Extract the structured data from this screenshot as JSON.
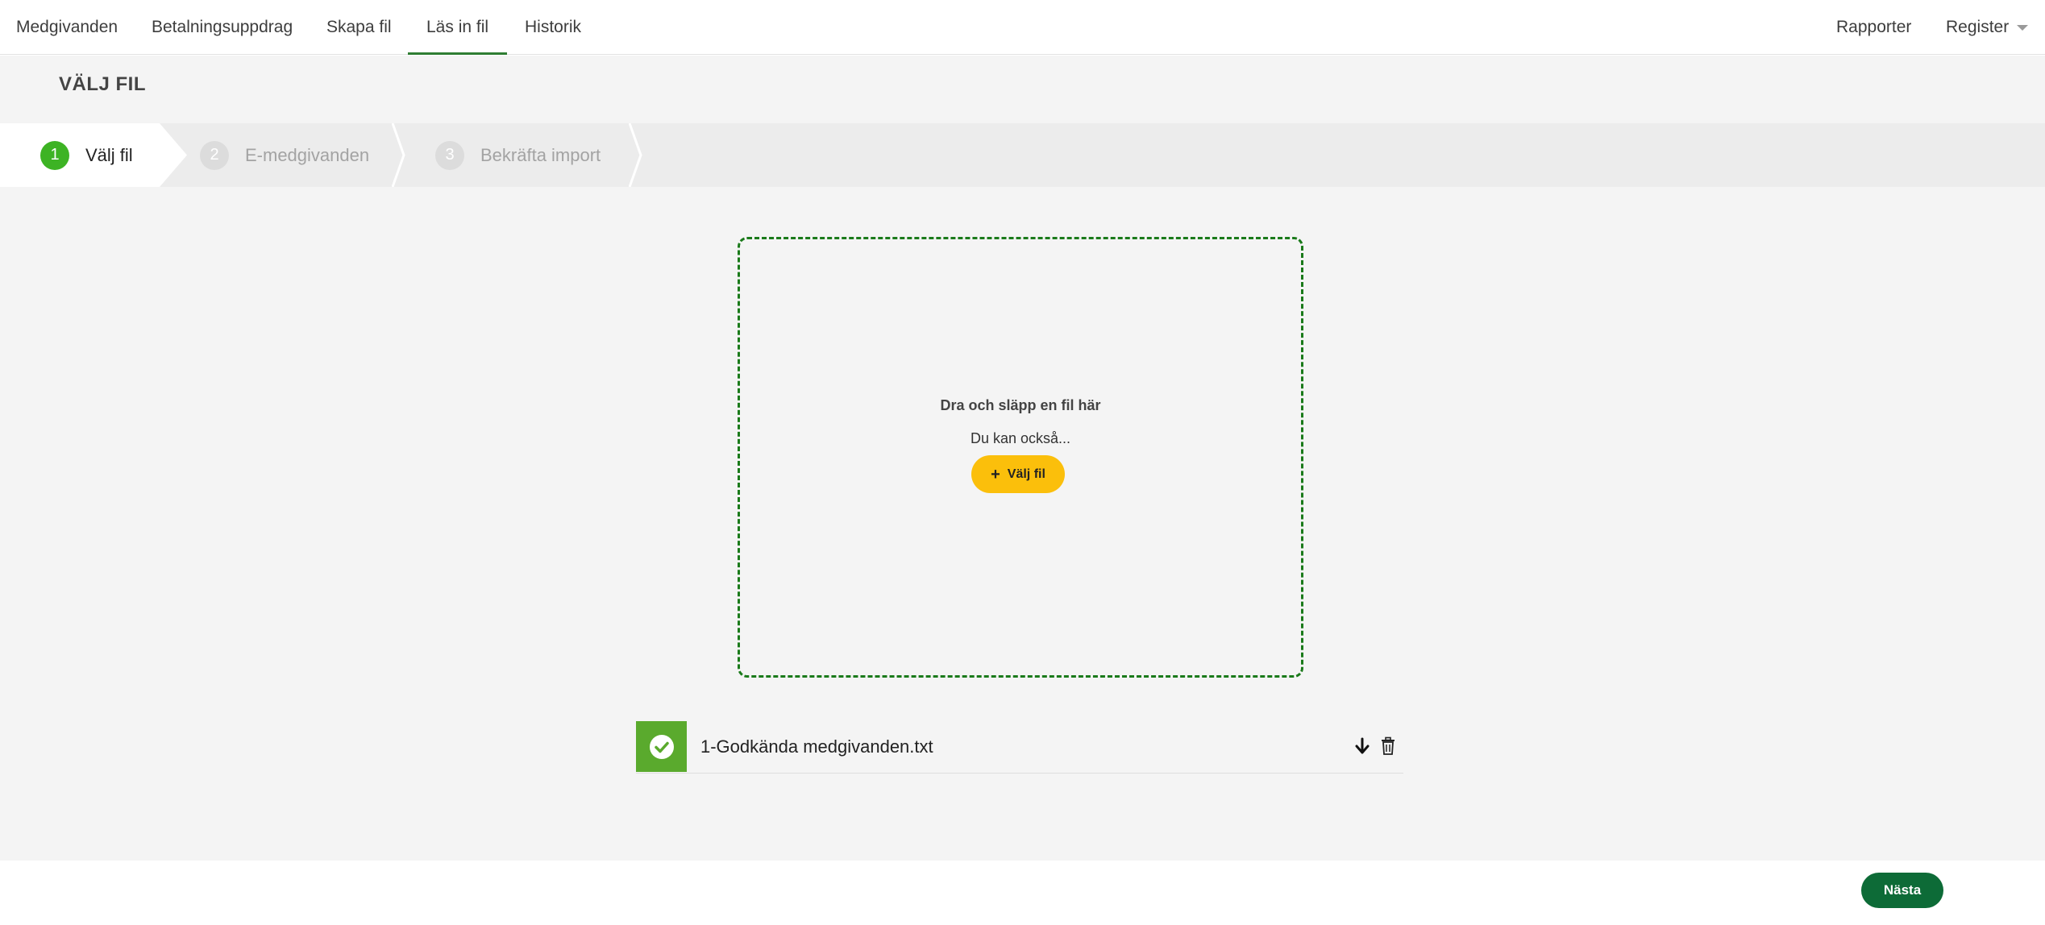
{
  "nav": {
    "items": [
      {
        "label": "Medgivanden"
      },
      {
        "label": "Betalningsuppdrag"
      },
      {
        "label": "Skapa fil"
      },
      {
        "label": "Läs in fil",
        "active": true
      },
      {
        "label": "Historik"
      }
    ],
    "right": {
      "reports": "Rapporter",
      "register": "Register"
    }
  },
  "page": {
    "title": "VÄLJ FIL"
  },
  "stepper": {
    "steps": [
      {
        "number": "1",
        "label": "Välj fil",
        "state": "active"
      },
      {
        "number": "2",
        "label": "E-medgivanden",
        "state": "inactive"
      },
      {
        "number": "3",
        "label": "Bekräfta import",
        "state": "inactive"
      }
    ]
  },
  "dropzone": {
    "title": "Dra och släpp en fil här",
    "subtitle": "Du kan också...",
    "button_label": "Välj fil",
    "border_color": "#1a7a1a"
  },
  "files": [
    {
      "name": "1-Godkända medgivanden.txt",
      "status_icon": "check-circle-icon",
      "status_color": "#5aaa2d"
    }
  ],
  "footer": {
    "next_label": "Nästa"
  },
  "colors": {
    "accent_green": "#2e7d32",
    "step_active": "#3db324",
    "primary_button": "#0d6b37",
    "choose_button": "#fbbf0b"
  }
}
